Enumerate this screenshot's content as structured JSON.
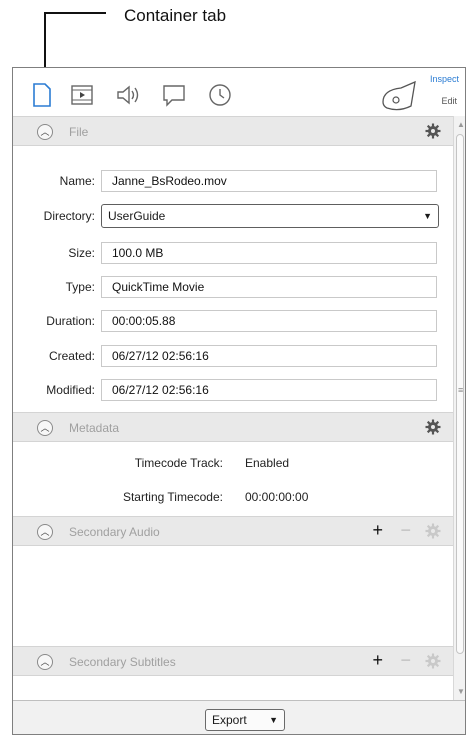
{
  "callout": {
    "text": "Container tab"
  },
  "toolbar": {
    "icons": [
      "document-icon",
      "film-icon",
      "audio-icon",
      "comment-icon",
      "clock-icon"
    ],
    "inspect_label": "Inspect",
    "edit_label": "Edit"
  },
  "sections": {
    "file": {
      "title": "File",
      "fields": [
        {
          "label": "Name:",
          "value": "Janne_BsRodeo.mov"
        },
        {
          "label": "Directory:",
          "value": "UserGuide"
        },
        {
          "label": "Size:",
          "value": "100.0 MB"
        },
        {
          "label": "Type:",
          "value": "QuickTime Movie"
        },
        {
          "label": "Duration:",
          "value": "00:00:05.88"
        },
        {
          "label": "Created:",
          "value": "06/27/12 02:56:16"
        },
        {
          "label": "Modified:",
          "value": "06/27/12 02:56:16"
        }
      ]
    },
    "metadata": {
      "title": "Metadata",
      "rows": [
        {
          "label": "Timecode Track:",
          "value": "Enabled"
        },
        {
          "label": "Starting Timecode:",
          "value": "00:00:00:00"
        }
      ]
    },
    "secondary_audio": {
      "title": "Secondary Audio",
      "add": "+",
      "remove": "−"
    },
    "secondary_subtitles": {
      "title": "Secondary Subtitles",
      "add": "+",
      "remove": "−"
    }
  },
  "footer": {
    "export_label": "Export"
  },
  "colors": {
    "accent": "#2b7cd3",
    "header_bg": "#e9e9e9"
  }
}
